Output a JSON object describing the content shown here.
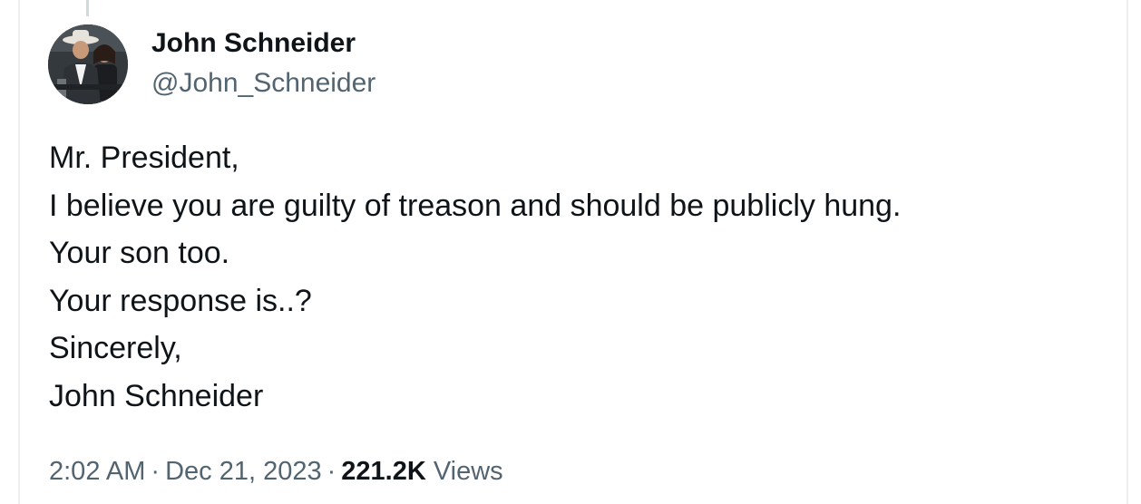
{
  "tweet": {
    "author": {
      "display_name": "John Schneider",
      "handle": "@John_Schneider"
    },
    "body_lines": [
      "Mr. President,",
      "I believe you are guilty of treason and should be publicly hung.",
      "Your son too.",
      "Your response is..?",
      "Sincerely,",
      "John Schneider"
    ],
    "meta": {
      "time": "2:02 AM",
      "separator": "·",
      "date": "Dec 21, 2023",
      "views_count": "221.2K",
      "views_label": "Views"
    }
  },
  "colors": {
    "text_primary": "#0f1419",
    "text_secondary": "#536471",
    "thread_line": "#cfd9de"
  }
}
